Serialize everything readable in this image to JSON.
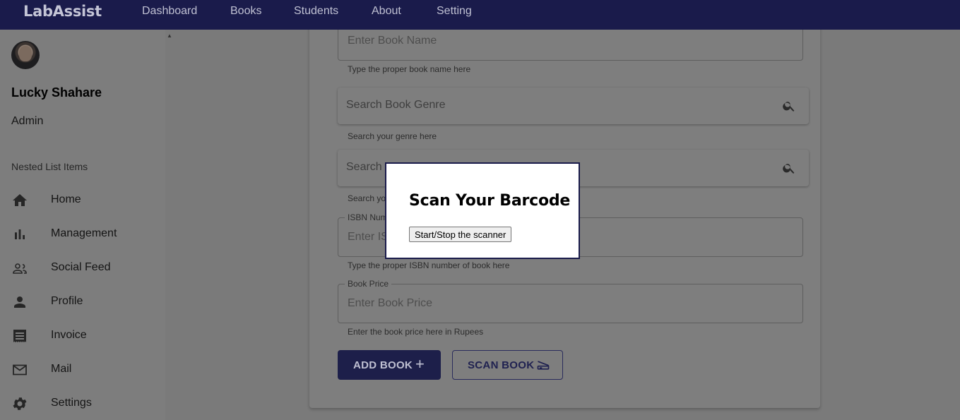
{
  "app": {
    "brand": "LabAssist"
  },
  "nav": [
    {
      "label": "Dashboard"
    },
    {
      "label": "Books"
    },
    {
      "label": "Students"
    },
    {
      "label": "About"
    },
    {
      "label": "Setting"
    }
  ],
  "sidebar": {
    "user_name": "Lucky Shahare",
    "user_role": "Admin",
    "section_title": "Nested List Items",
    "items": [
      {
        "label": "Home",
        "icon": "home-icon"
      },
      {
        "label": "Management",
        "icon": "bar-chart-icon"
      },
      {
        "label": "Social Feed",
        "icon": "people-icon"
      },
      {
        "label": "Profile",
        "icon": "person-icon"
      },
      {
        "label": "Invoice",
        "icon": "receipt-icon"
      },
      {
        "label": "Mail",
        "icon": "mail-icon"
      },
      {
        "label": "Settings",
        "icon": "gear-icon"
      }
    ]
  },
  "form": {
    "book_name": {
      "placeholder": "Enter Book Name",
      "helper": "Type the proper book name here"
    },
    "genre": {
      "placeholder": "Search Book Genre",
      "helper": "Search your genre here"
    },
    "author": {
      "placeholder": "Search",
      "helper": "Search yo"
    },
    "isbn": {
      "label": "ISBN Num",
      "placeholder": "Enter IS",
      "helper": "Type the proper ISBN number of book here"
    },
    "price": {
      "label": "Book Price",
      "placeholder": "Enter Book Price",
      "helper": "Enter the book price here in Rupees"
    },
    "add_button": "ADD BOOK",
    "scan_button": "SCAN BOOK"
  },
  "modal": {
    "title": "Scan Your Barcode",
    "button": "Start/Stop the scanner"
  },
  "colors": {
    "appbar": "#1a1b4b",
    "overlay_gray": "#7a7a7a",
    "accent": "#1d1f4a"
  }
}
